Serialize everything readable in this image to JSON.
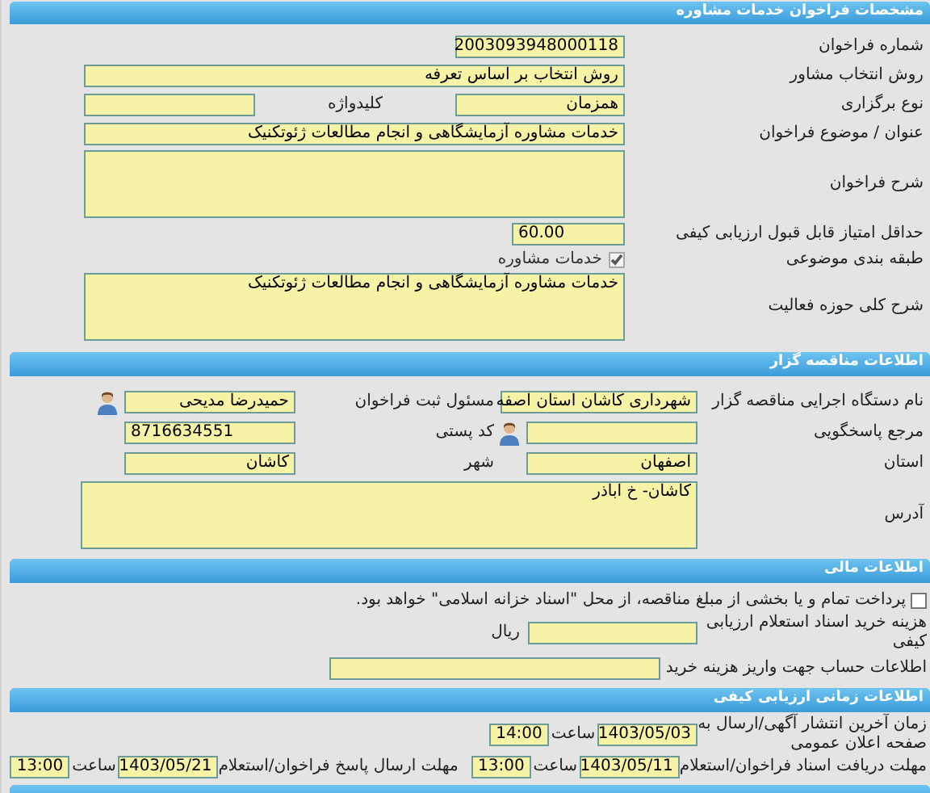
{
  "call_details": {
    "title": "مشخصات فراخوان خدمات مشاوره",
    "call_number": {
      "label": "شماره فراخوان",
      "value": "2003093948000118"
    },
    "selection_method": {
      "label": "روش انتخاب مشاور",
      "value": "روش انتخاب بر اساس تعرفه"
    },
    "holding_type": {
      "label": "نوع برگزاری",
      "value": "همزمان"
    },
    "keyword": {
      "label": "کلیدواژه"
    },
    "subject": {
      "label": "عنوان / موضوع فراخوان",
      "value": "خدمات مشاوره آزمایشگاهی و انجام مطالعات ژئوتکنیک"
    },
    "description": {
      "label": "شرح فراخوان"
    },
    "min_score": {
      "label": "حداقل امتیاز قابل قبول ارزیابی کیفی",
      "value": "60.00"
    },
    "category": {
      "label": "طبقه بندی موضوعی",
      "option": "خدمات مشاوره",
      "checked": true,
      "disabled": true
    },
    "activity_scope": {
      "label": "شرح کلی حوزه فعالیت",
      "value": "خدمات مشاوره آزمایشگاهی و انجام مطالعات ژئوتکنیک"
    }
  },
  "tender_organizer": {
    "title": "اطلاعات مناقصه گزار",
    "org_name": {
      "label": "نام دستگاه اجرایی مناقصه گزار",
      "value": "شهرداری کاشان استان اصفه"
    },
    "registrar": {
      "label": "مسئول ثبت فراخوان",
      "value": "حمیدرضا مدیحی"
    },
    "responder": {
      "label": "مرجع پاسخگویی"
    },
    "postal_code": {
      "label": "کد پستی",
      "value": "8716634551"
    },
    "province": {
      "label": "استان",
      "value": "اصفهان"
    },
    "city": {
      "label": "شهر",
      "value": "کاشان"
    },
    "address": {
      "label": "آدرس",
      "value": "کاشان- خ اباذر"
    }
  },
  "financial": {
    "title": "اطلاعات مالی",
    "treasury_payment": {
      "text": "پرداخت تمام و یا بخشی از مبلغ مناقصه، از محل \"اسناد خزانه اسلامی\" خواهد بود.",
      "checked": false
    },
    "purchase_cost": {
      "label": "هزینه خرید اسناد استعلام ارزیابی کیفی",
      "unit": "ریال"
    },
    "account_info": {
      "label": "اطلاعات حساب جهت واریز هزینه خرید"
    }
  },
  "timing": {
    "title": "اطلاعات زمانی ارزیابی کیفی",
    "rows": [
      {
        "label": "زمان آخرین انتشار آگهی/ارسال به صفحه اعلان عمومی",
        "date": "1403/05/03",
        "time_label": "ساعت",
        "time": "14:00"
      },
      {
        "label": "مهلت دریافت اسناد فراخوان/استعلام",
        "date": "1403/05/11",
        "time_label": "ساعت",
        "time": "13:00",
        "second_label": "مهلت ارسال پاسخ فراخوان/استعلام",
        "second_date": "1403/05/21",
        "second_time_label": "ساعت",
        "second_time": "13:00"
      }
    ]
  }
}
